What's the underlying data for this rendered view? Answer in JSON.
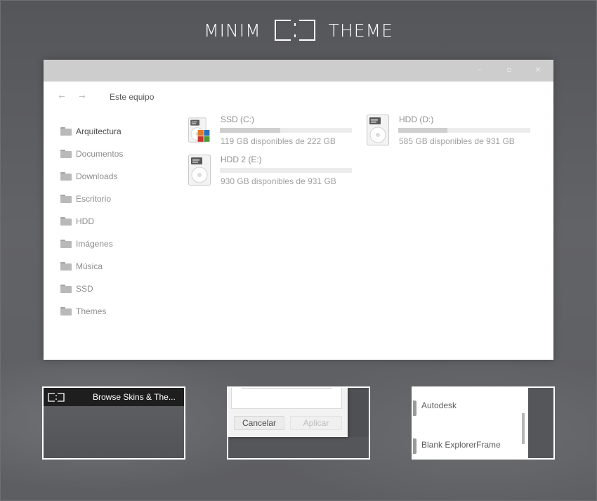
{
  "header": {
    "left_word": "MINIM",
    "right_word": "THEME",
    "logo_icon": "bracket-square-logo"
  },
  "window": {
    "controls": {
      "minimize": "–",
      "maximize": "▫",
      "close": "×"
    },
    "nav": {
      "back": "←",
      "forward": "→",
      "breadcrumb": "Este equipo"
    },
    "sidebar": {
      "items": [
        {
          "label": "Arquitectura",
          "active": true
        },
        {
          "label": "Documentos"
        },
        {
          "label": "Downloads"
        },
        {
          "label": "Escritorio"
        },
        {
          "label": "HDD"
        },
        {
          "label": "Imágenes"
        },
        {
          "label": "Música"
        },
        {
          "label": "SSD"
        },
        {
          "label": "Themes"
        }
      ]
    },
    "drives": [
      {
        "name": "SSD (C:)",
        "free_text": "119 GB disponibles de 222 GB",
        "used_fraction": 0.46,
        "icon": "system-drive-icon"
      },
      {
        "name": "HDD (D:)",
        "free_text": "585 GB disponibles de 931 GB",
        "used_fraction": 0.37,
        "icon": "hard-drive-icon"
      },
      {
        "name": "HDD 2 (E:)",
        "free_text": "930 GB disponibles de 931 GB",
        "used_fraction": 0.0,
        "icon": "hard-drive-icon"
      }
    ]
  },
  "thumbnails": {
    "skins": {
      "title": "Browse Skins & The..."
    },
    "dialog": {
      "cancel_label": "Cancelar",
      "apply_label": "Aplicar"
    },
    "list": {
      "items": [
        "Autodesk",
        "Blank ExplorerFrame"
      ]
    }
  },
  "colors": {
    "background": "#5b5c60",
    "titlebar": "#cdcdcd",
    "accent_orange": "#e07b27",
    "accent_blue": "#2c6fbf",
    "accent_green": "#4f9a37",
    "accent_red": "#c9352f"
  }
}
